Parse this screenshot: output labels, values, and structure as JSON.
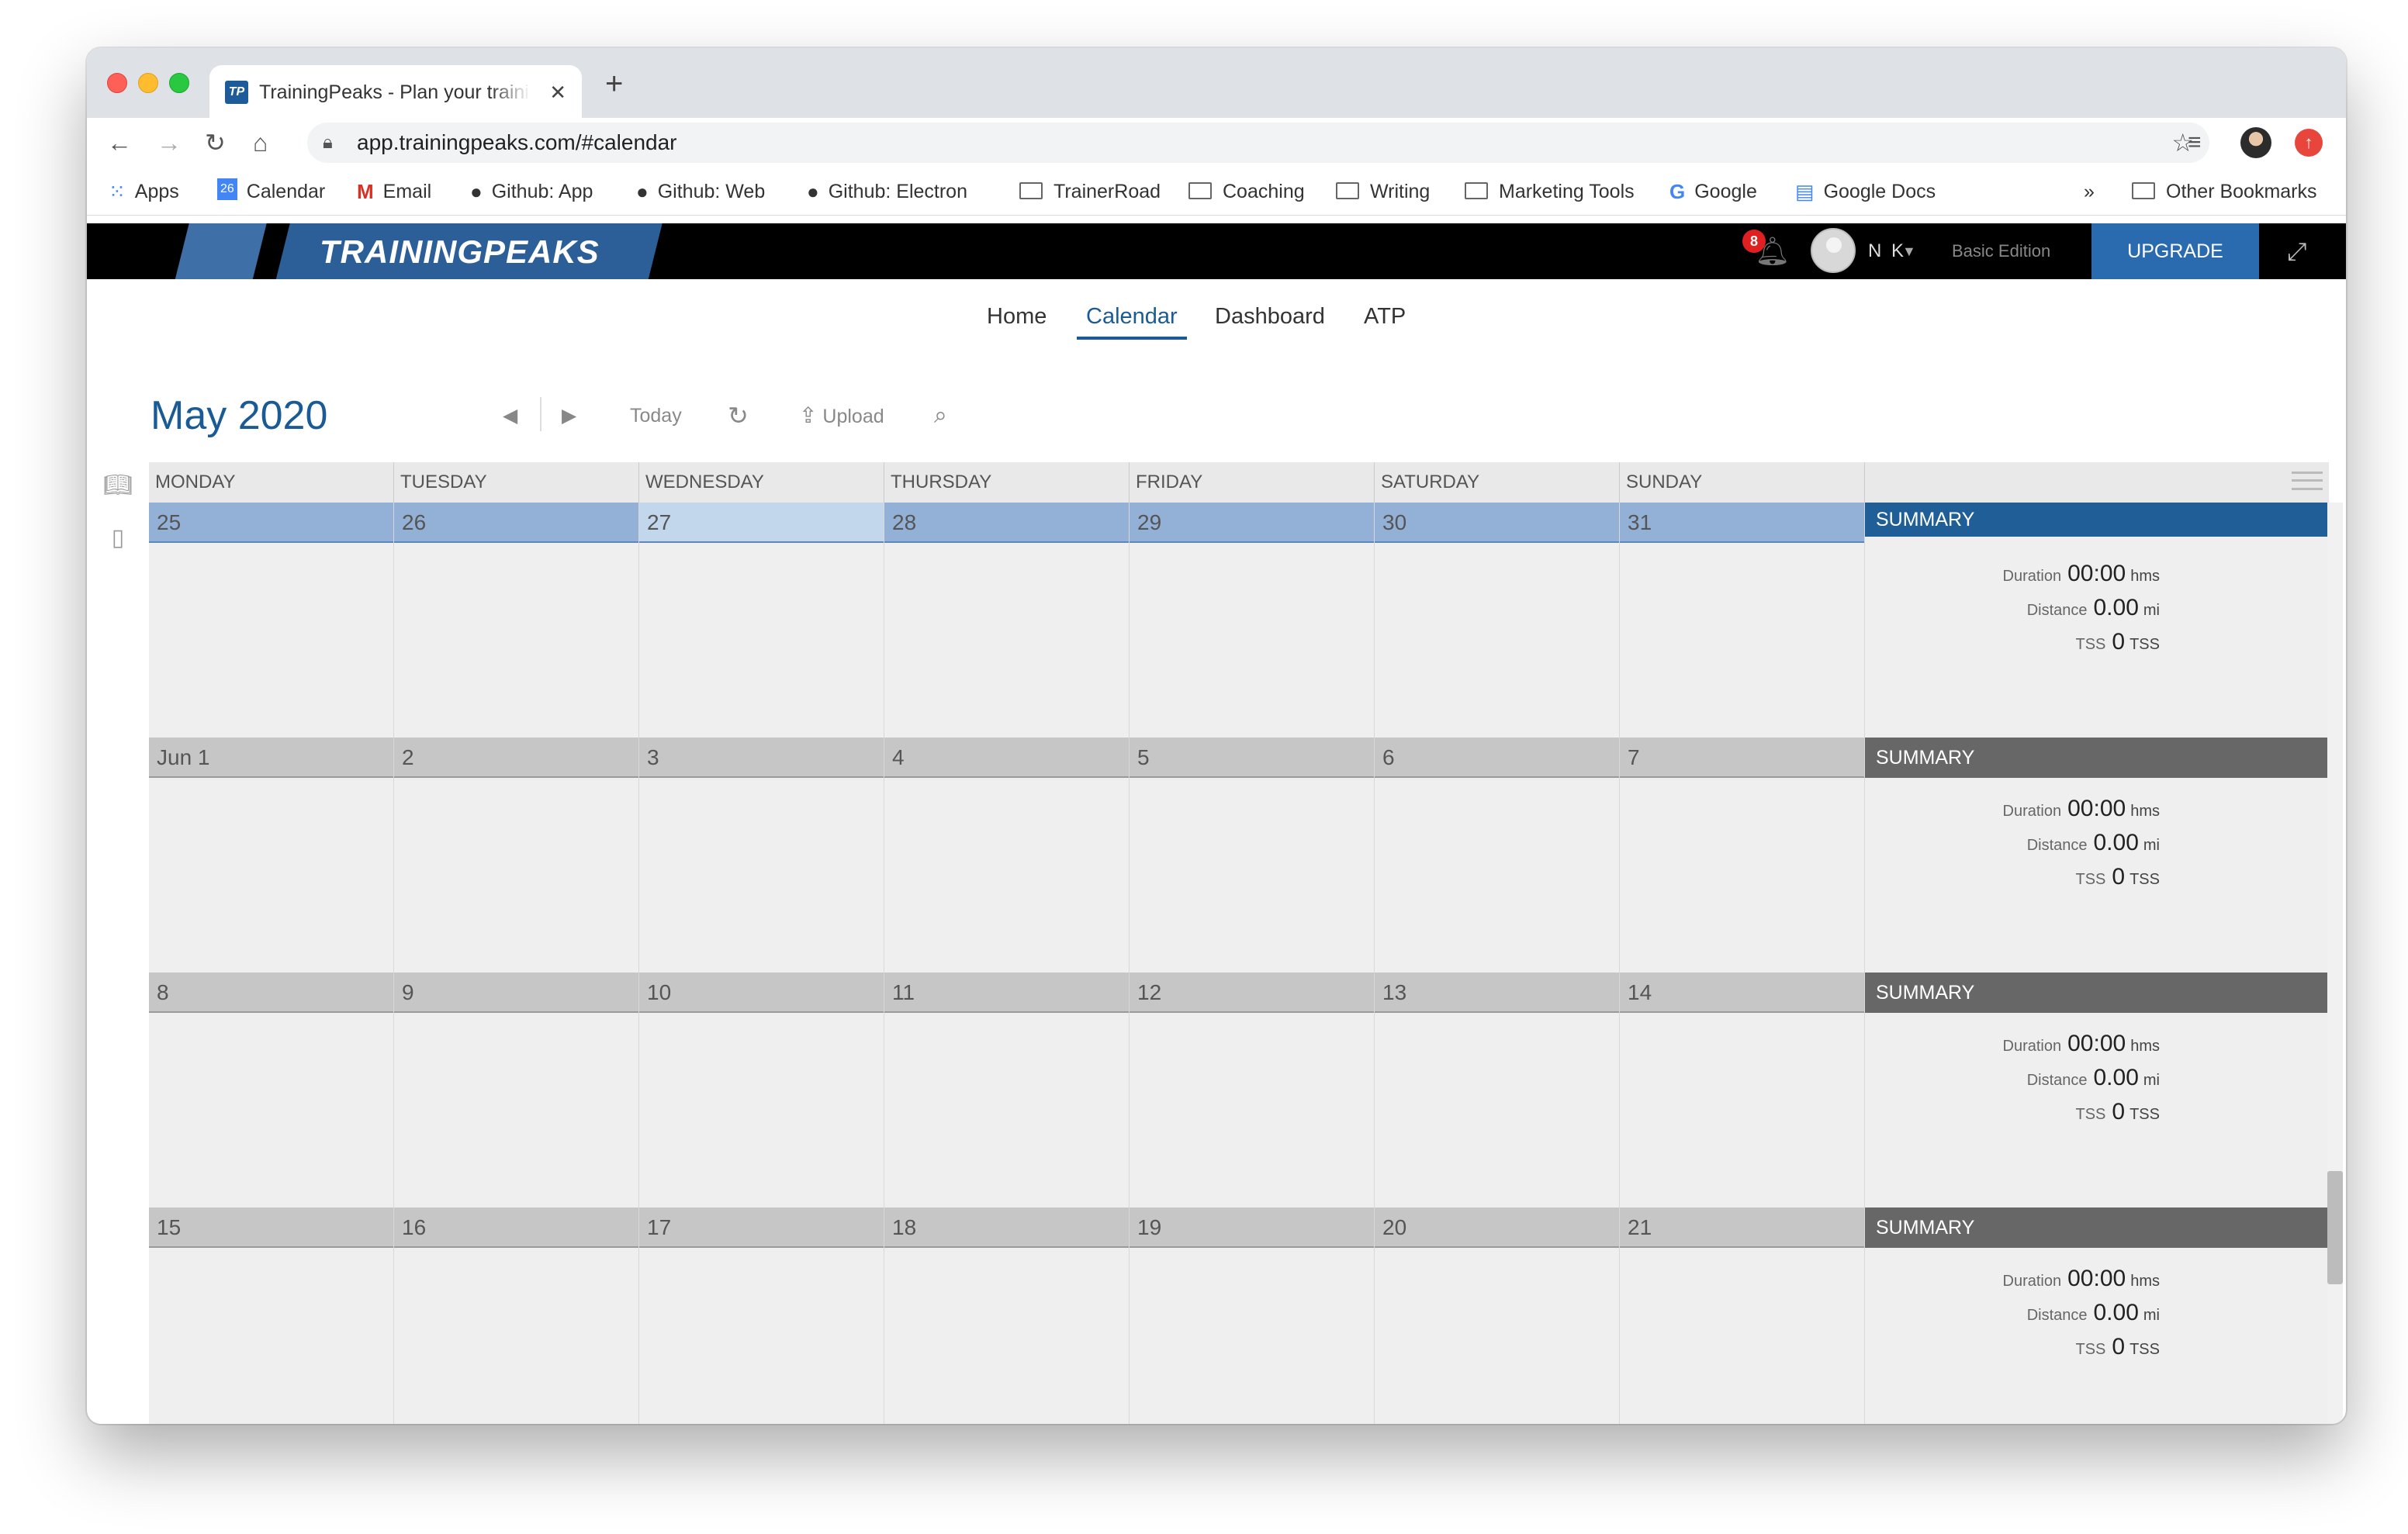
{
  "browser": {
    "tab_title": "TrainingPeaks - Plan your training",
    "tab_favicon": "TP",
    "url": "app.trainingpeaks.com/#calendar",
    "bookmarks": [
      {
        "label": "Apps",
        "icon": "apps-grid-icon"
      },
      {
        "label": "Calendar",
        "icon": "calendar-icon"
      },
      {
        "label": "Email",
        "icon": "gmail-icon"
      },
      {
        "label": "Github: App",
        "icon": "github-icon"
      },
      {
        "label": "Github: Web",
        "icon": "github-icon"
      },
      {
        "label": "Github: Electron",
        "icon": "github-icon"
      },
      {
        "label": "TrainerRoad",
        "icon": "folder-icon"
      },
      {
        "label": "Coaching",
        "icon": "folder-icon"
      },
      {
        "label": "Writing",
        "icon": "folder-icon"
      },
      {
        "label": "Marketing Tools",
        "icon": "folder-icon"
      },
      {
        "label": "Google",
        "icon": "google-icon"
      },
      {
        "label": "Google Docs",
        "icon": "google-docs-icon"
      }
    ],
    "bookmarks_overflow": "»",
    "other_bookmarks": "Other Bookmarks",
    "calendar_favicon_day": "26"
  },
  "app": {
    "logo": "TRAININGPEAKS",
    "notification_count": "8",
    "user_initials": "N K",
    "edition": "Basic Edition",
    "upgrade_label": "UPGRADE",
    "nav": [
      "Home",
      "Calendar",
      "Dashboard",
      "ATP"
    ],
    "active_nav": "Calendar"
  },
  "calendar": {
    "month": "May",
    "year": "2020",
    "today_label": "Today",
    "upload_label": "Upload",
    "day_headers": [
      "MONDAY",
      "TUESDAY",
      "WEDNESDAY",
      "THURSDAY",
      "FRIDAY",
      "SATURDAY",
      "SUNDAY"
    ],
    "weeks": [
      {
        "days": [
          "25",
          "26",
          "27",
          "28",
          "29",
          "30",
          "31"
        ],
        "current": true,
        "today_index": 2
      },
      {
        "days": [
          "Jun 1",
          "2",
          "3",
          "4",
          "5",
          "6",
          "7"
        ]
      },
      {
        "days": [
          "8",
          "9",
          "10",
          "11",
          "12",
          "13",
          "14"
        ]
      },
      {
        "days": [
          "15",
          "16",
          "17",
          "18",
          "19",
          "20",
          "21"
        ]
      }
    ],
    "summary": {
      "title": "SUMMARY",
      "duration_label": "Duration",
      "duration_value": "00:00",
      "duration_unit": "hms",
      "distance_label": "Distance",
      "distance_value": "0.00",
      "distance_unit": "mi",
      "tss_label": "TSS",
      "tss_value": "0",
      "tss_unit": "TSS"
    }
  },
  "colors": {
    "brand_blue": "#1a5b96",
    "upgrade_blue": "#2a6bb0",
    "current_week": "#93b1d7",
    "summary_current": "#1f5e96",
    "summary_other": "#676767"
  }
}
